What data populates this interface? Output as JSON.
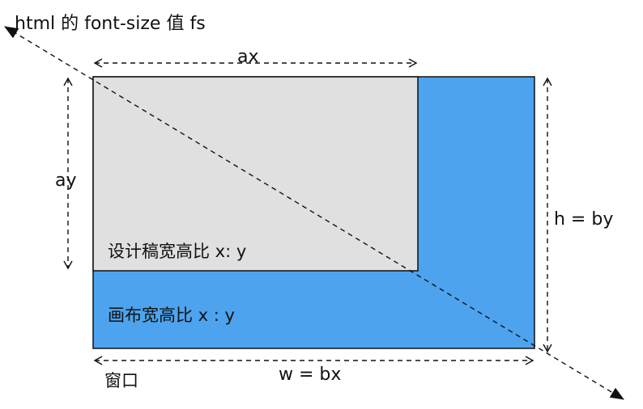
{
  "labels": {
    "diagonal": "html 的 font-size 值 fs",
    "ax": "ax",
    "ay": "ay",
    "design_ratio": "设计稿宽高比 x: y",
    "canvas_ratio": "画布宽高比 x : y",
    "height": "h = by",
    "width": "w = bx",
    "window": "窗口"
  },
  "colors": {
    "canvas_fill": "#4da3ee",
    "design_fill": "#e0e0e0",
    "stroke": "#111111"
  }
}
